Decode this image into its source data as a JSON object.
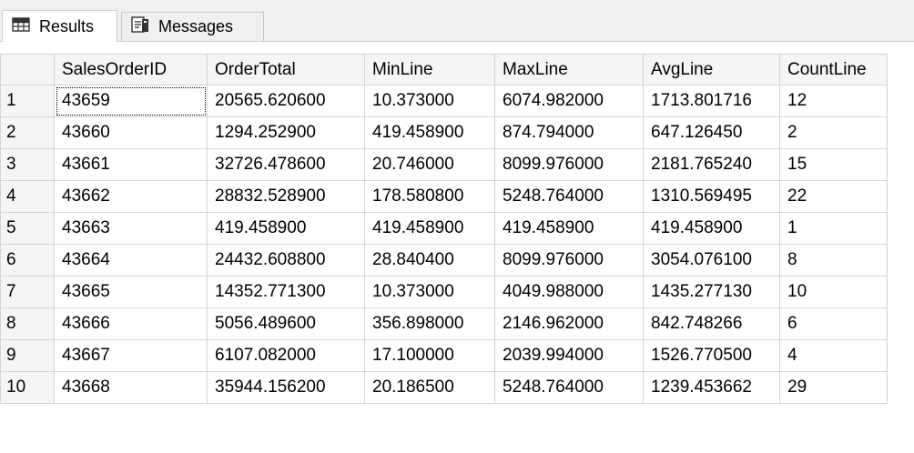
{
  "tabs": [
    {
      "label": "Results",
      "icon": "grid-icon",
      "active": true
    },
    {
      "label": "Messages",
      "icon": "messages-icon",
      "active": false
    }
  ],
  "grid": {
    "columns": [
      "",
      "SalesOrderID",
      "OrderTotal",
      "MinLine",
      "MaxLine",
      "AvgLine",
      "CountLine"
    ],
    "rows": [
      [
        "1",
        "43659",
        "20565.620600",
        "10.373000",
        "6074.982000",
        "1713.801716",
        "12"
      ],
      [
        "2",
        "43660",
        "1294.252900",
        "419.458900",
        "874.794000",
        "647.126450",
        "2"
      ],
      [
        "3",
        "43661",
        "32726.478600",
        "20.746000",
        "8099.976000",
        "2181.765240",
        "15"
      ],
      [
        "4",
        "43662",
        "28832.528900",
        "178.580800",
        "5248.764000",
        "1310.569495",
        "22"
      ],
      [
        "5",
        "43663",
        "419.458900",
        "419.458900",
        "419.458900",
        "419.458900",
        "1"
      ],
      [
        "6",
        "43664",
        "24432.608800",
        "28.840400",
        "8099.976000",
        "3054.076100",
        "8"
      ],
      [
        "7",
        "43665",
        "14352.771300",
        "10.373000",
        "4049.988000",
        "1435.277130",
        "10"
      ],
      [
        "8",
        "43666",
        "5056.489600",
        "356.898000",
        "2146.962000",
        "842.748266",
        "6"
      ],
      [
        "9",
        "43667",
        "6107.082000",
        "17.100000",
        "2039.994000",
        "1526.770500",
        "4"
      ],
      [
        "10",
        "43668",
        "35944.156200",
        "20.186500",
        "5248.764000",
        "1239.453662",
        "29"
      ]
    ]
  }
}
